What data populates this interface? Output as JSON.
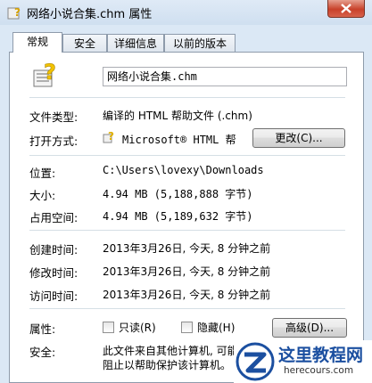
{
  "window": {
    "title": "网络小说合集.chm 属性"
  },
  "tabs": [
    {
      "label": "常规",
      "active": true
    },
    {
      "label": "安全",
      "active": false
    },
    {
      "label": "详细信息",
      "active": false
    },
    {
      "label": "以前的版本",
      "active": false
    }
  ],
  "general": {
    "file_name": "网络小说合集.chm",
    "file_type_label": "文件类型:",
    "file_type_value": "编译的 HTML 帮助文件 (.chm)",
    "open_with_label": "打开方式:",
    "open_with_value": "Microsoft® HTML 帮助",
    "change_button": "更改(C)...",
    "location_label": "位置:",
    "location_value": "C:\\Users\\lovexy\\Downloads",
    "size_label": "大小:",
    "size_value": "4.94 MB (5,188,888 字节)",
    "disk_size_label": "占用空间:",
    "disk_size_value": "4.94 MB (5,189,632 字节)",
    "created_label": "创建时间:",
    "created_value": "2013年3月26日, 今天, 8 分钟之前",
    "modified_label": "修改时间:",
    "modified_value": "2013年3月26日, 今天, 8 分钟之前",
    "accessed_label": "访问时间:",
    "accessed_value": "2013年3月26日, 今天, 8 分钟之前",
    "attributes_label": "属性:",
    "readonly_label": "只读(R)",
    "hidden_label": "隐藏(H)",
    "advanced_button": "高级(D)...",
    "security_label": "安全:",
    "security_text_1": "此文件来自其他计算机, 可能",
    "security_text_2": "阻止以帮助保护该计算机。"
  },
  "watermark": {
    "title": "这里教程网",
    "url": "herecours.com"
  },
  "colors": {
    "title_bar": "#dbe8f5",
    "close_button": "#c8412a",
    "watermark_blue": "#1b4fa0"
  },
  "icons": [
    "chm-file-icon",
    "help-program-icon",
    "close-icon"
  ]
}
